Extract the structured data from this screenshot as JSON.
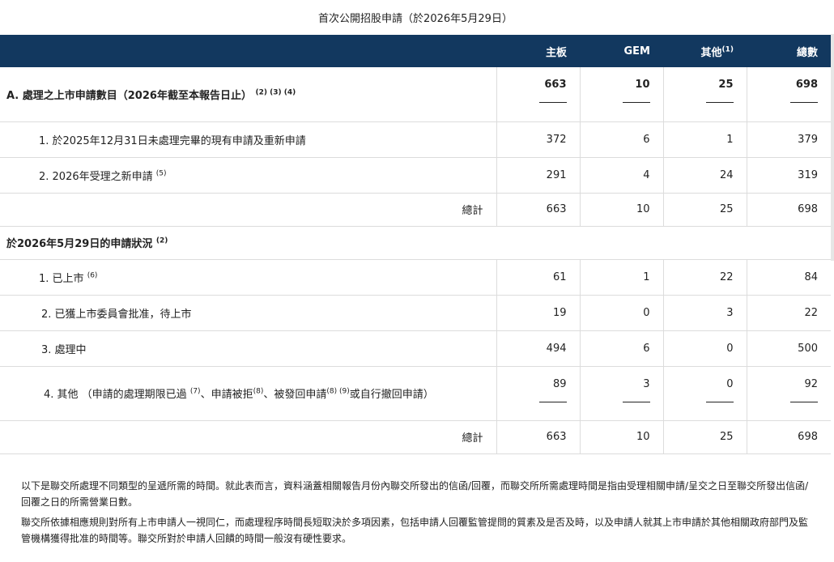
{
  "title": "首次公開招股申請（於2026年5月29日）",
  "header": {
    "col1": "主板",
    "col2": "GEM",
    "col3": "其他",
    "col3_sup": "(1)",
    "col4": "總數"
  },
  "row_a": {
    "label": "A. 處理之上市申請數目（2026年截至本報告日止）",
    "sup": "(2) (3) (4)",
    "v1": "663",
    "v2": "10",
    "v3": "25",
    "v4": "698"
  },
  "row_a1": {
    "label": "1. 於2025年12月31日未處理完畢的現有申請及重新申請",
    "v1": "372",
    "v2": "6",
    "v3": "1",
    "v4": "379"
  },
  "row_a2": {
    "label": "2. 2026年受理之新申請",
    "sup": "(5)",
    "v1": "291",
    "v2": "4",
    "v3": "24",
    "v4": "319"
  },
  "total1": {
    "label": "總計",
    "v1": "663",
    "v2": "10",
    "v3": "25",
    "v4": "698"
  },
  "section_b": {
    "label": "於2026年5月29日的申請狀況",
    "sup": "(2)"
  },
  "row_b1": {
    "label": "1. 已上市",
    "sup": "(6)",
    "v1": "61",
    "v2": "1",
    "v3": "22",
    "v4": "84"
  },
  "row_b2": {
    "label": "2. 已獲上市委員會批准，待上市",
    "v1": "19",
    "v2": "0",
    "v3": "3",
    "v4": "22"
  },
  "row_b3": {
    "label": "3. 處理中",
    "v1": "494",
    "v2": "6",
    "v3": "0",
    "v4": "500"
  },
  "row_b4": {
    "label_start": "4. 其他 （申請的處理期限已過",
    "sup1": "(7)",
    "label_mid1": "、申請被拒",
    "sup2": "(8)",
    "label_mid2": "、被發回申請",
    "sup3": "(8) (9)",
    "label_end": "或自行撤回申請）",
    "v1": "89",
    "v2": "3",
    "v3": "0",
    "v4": "92"
  },
  "total2": {
    "label": "總計",
    "v1": "663",
    "v2": "10",
    "v3": "25",
    "v4": "698"
  },
  "notes": {
    "p1": "以下是聯交所處理不同類型的呈遞所需的時間。就此表而言，資料涵蓋相關報告月份內聯交所發出的信函/回覆，而聯交所所需處理時間是指由受理相關申請/呈交之日至聯交所發出信函/回覆之日的所需營業日數。",
    "p2": "聯交所依據相應規則對所有上市申請人一視同仁，而處理程序時間長短取決於多項因素，包括申請人回覆監管提問的質素及是否及時，以及申請人就其上市申請於其他相關政府部門及監管機構獲得批准的時間等。聯交所對於申請人回饋的時間一般沒有硬性要求。"
  }
}
